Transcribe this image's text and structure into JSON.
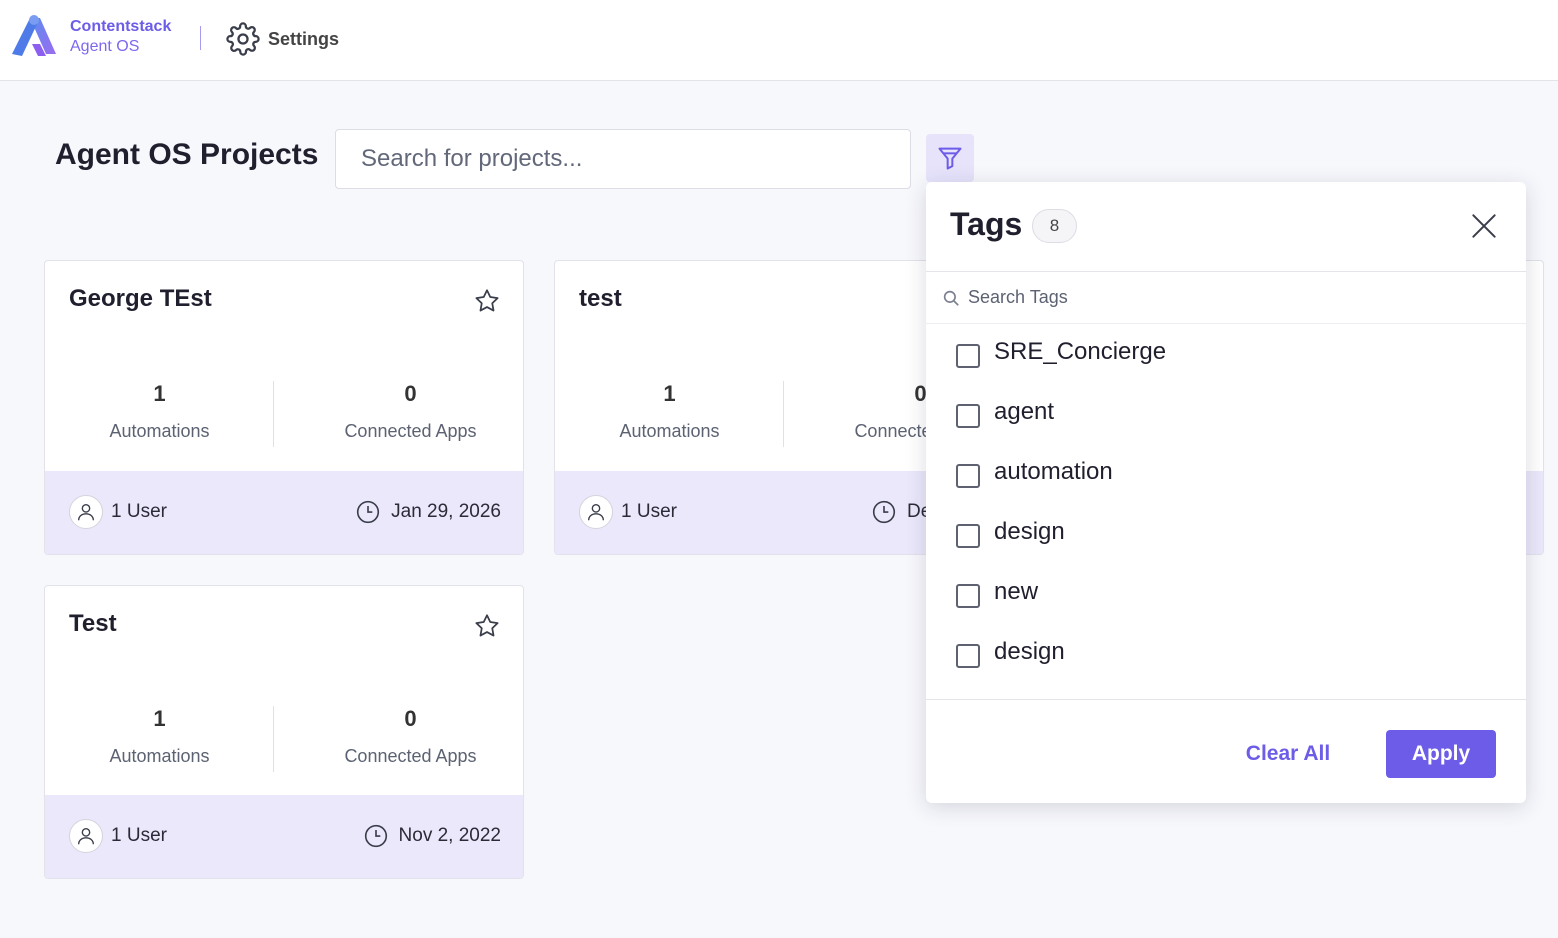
{
  "header": {
    "brand_name": "Contentstack",
    "brand_sub": "Agent OS",
    "settings_label": "Settings",
    "logo_icon": "contentstack-logo",
    "settings_icon": "gear-icon"
  },
  "page": {
    "title": "Agent OS Projects",
    "search_placeholder": "Search for projects...",
    "filter_icon": "filter-icon"
  },
  "colors": {
    "accent": "#6c5ce7",
    "card_footer": "#ebe8fb",
    "filter_bg": "#e6e3fb"
  },
  "projects": [
    {
      "name": "George TEst",
      "automations": "1",
      "automations_label": "Automations",
      "apps": "0",
      "apps_label": "Connected Apps",
      "users": "1 User",
      "date": "Jan 29, 2026"
    },
    {
      "name": "test",
      "automations": "1",
      "automations_label": "Automations",
      "apps": "0",
      "apps_label": "Connected Apps",
      "users": "1 User",
      "date": "Dec"
    },
    {
      "name": "Test",
      "automations": "1",
      "automations_label": "Automations",
      "apps": "0",
      "apps_label": "Connected Apps",
      "users": "1 User",
      "date": "Nov 2, 2022"
    }
  ],
  "tags_panel": {
    "title": "Tags",
    "count": "8",
    "search_placeholder": "Search Tags",
    "items": [
      {
        "label": "SRE_Concierge",
        "checked": false
      },
      {
        "label": "agent",
        "checked": false
      },
      {
        "label": "automation",
        "checked": false
      },
      {
        "label": "design",
        "checked": false
      },
      {
        "label": "new",
        "checked": false
      },
      {
        "label": "design",
        "checked": false
      }
    ],
    "clear_label": "Clear All",
    "apply_label": "Apply"
  }
}
